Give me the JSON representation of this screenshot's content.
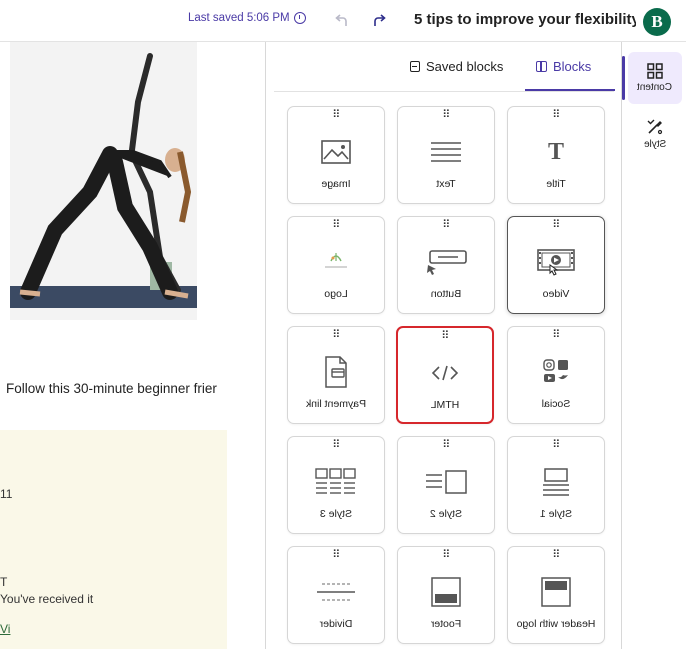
{
  "topbar": {
    "title": "5 tips to improve your flexibility...",
    "last_saved": "Last saved 5:06 PM",
    "logo_letter": "B",
    "brand_color": "#0a6b4c",
    "accent_color": "#4a3aa6"
  },
  "preview": {
    "intro_text": "Follow this 30-minute beginner frier",
    "footer_number": "11",
    "footer_letter": "T",
    "footer_received": "You've received it",
    "footer_link": "Vi"
  },
  "panel": {
    "tabs": [
      {
        "label": "Blocks",
        "icon": "panel-icon",
        "active": true
      },
      {
        "label": "Saved blocks",
        "icon": "bookmark-icon",
        "active": false
      }
    ],
    "blocks": [
      {
        "label": "Title",
        "icon": "title-icon"
      },
      {
        "label": "Text",
        "icon": "text-icon"
      },
      {
        "label": "Image",
        "icon": "image-icon"
      },
      {
        "label": "Video",
        "icon": "video-icon"
      },
      {
        "label": "Button",
        "icon": "button-icon"
      },
      {
        "label": "Logo",
        "icon": "logo-icon"
      },
      {
        "label": "Social",
        "icon": "social-icon"
      },
      {
        "label": "HTML",
        "icon": "html-icon"
      },
      {
        "label": "Payment link",
        "icon": "payment-link-icon"
      },
      {
        "label": "Style 1",
        "icon": "style-1-icon"
      },
      {
        "label": "Style 2",
        "icon": "style-2-icon"
      },
      {
        "label": "Style 3",
        "icon": "style-3-icon"
      },
      {
        "label": "Header with logo",
        "icon": "header-with-logo-icon"
      },
      {
        "label": "Footer",
        "icon": "footer-icon"
      },
      {
        "label": "Divider",
        "icon": "divider-icon"
      }
    ]
  },
  "rail": {
    "content_label": "Content",
    "style_label": "Style"
  }
}
